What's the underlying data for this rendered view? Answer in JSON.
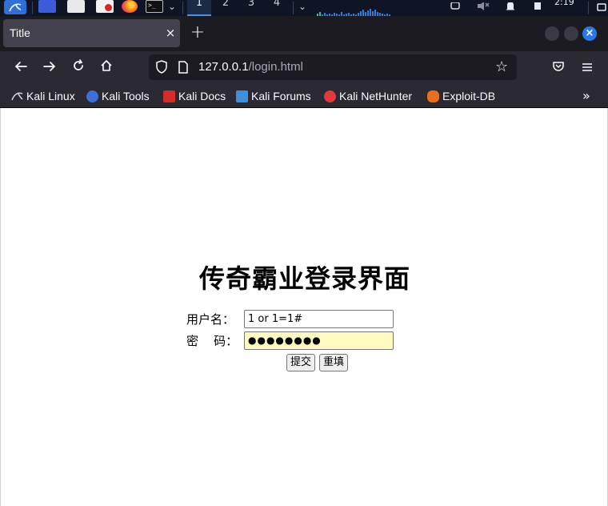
{
  "os": {
    "workspaces": [
      "1",
      "2",
      "3",
      "4"
    ],
    "active_workspace": "1",
    "clock": "2:19",
    "icons": [
      "kali-menu-icon",
      "file-manager-icon",
      "text-editor-icon",
      "burp-icon",
      "firefox-icon",
      "terminal-icon",
      "network-icon",
      "mute-icon",
      "notification-icon",
      "battery-icon"
    ]
  },
  "browser": {
    "tab_title": "Title",
    "tab_close": "×",
    "new_tab": "+",
    "url_host": "127.0.0.1",
    "url_path": "/login.html",
    "bookmarks": [
      {
        "label": "Kali Linux",
        "color": "#3a3a3a"
      },
      {
        "label": "Kali Tools",
        "color": "#3d6fd8"
      },
      {
        "label": "Kali Docs",
        "color": "#d62b2b"
      },
      {
        "label": "Kali Forums",
        "color": "#3d8fe0"
      },
      {
        "label": "Kali NetHunter",
        "color": "#e03a3a"
      },
      {
        "label": "Exploit-DB",
        "color": "#e8701c"
      }
    ],
    "bookmarks_overflow": "»"
  },
  "login": {
    "title": "传奇霸业登录界面",
    "username_label": "用户名：",
    "username_value": "1 or 1=1#",
    "password_label": "密    码：",
    "password_mask": "●●●●●●●●",
    "submit_label": "提交",
    "reset_label": "重填"
  },
  "colors": {
    "accent": "#2b78e4",
    "toolbar": "#2b2a33",
    "tabstrip": "#1c1b22",
    "autofill": "#fffac0"
  }
}
